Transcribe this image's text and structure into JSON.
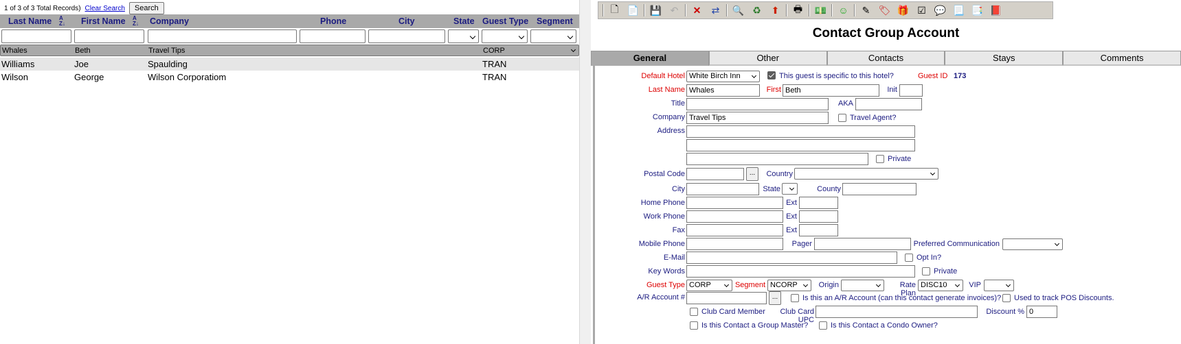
{
  "list": {
    "record_count": "1 of 3 of 3 Total Records)",
    "clear_search": "Clear Search",
    "search_button": "Search",
    "columns": {
      "last_name": "Last Name",
      "first_name": "First Name",
      "company": "Company",
      "phone": "Phone",
      "city": "City",
      "state": "State",
      "guest_type": "Guest Type",
      "segment": "Segment"
    },
    "rows": [
      {
        "last_name": "Whales",
        "first_name": "Beth",
        "company": "Travel Tips",
        "guest_type": "CORP"
      },
      {
        "last_name": "Williams",
        "first_name": "Joe",
        "company": "Spaulding",
        "guest_type": "TRAN"
      },
      {
        "last_name": "Wilson",
        "first_name": "George",
        "company": "Wilson Corporatiom",
        "guest_type": "TRAN"
      }
    ]
  },
  "form": {
    "title": "Contact Group Account",
    "tabs": [
      "General",
      "Other",
      "Contacts",
      "Stays",
      "Comments"
    ],
    "labels": {
      "default_hotel": "Default Hotel",
      "hotel_specific": "This guest is specific to this hotel?",
      "guest_id": "Guest ID",
      "last_name": "Last Name",
      "first": "First",
      "init": "Init",
      "title": "Title",
      "aka": "AKA",
      "company": "Company",
      "travel_agent": "Travel Agent?",
      "address": "Address",
      "private": "Private",
      "postal_code": "Postal Code",
      "country": "Country",
      "city": "City",
      "state": "State",
      "county": "County",
      "home_phone": "Home Phone",
      "work_phone": "Work Phone",
      "fax": "Fax",
      "ext": "Ext",
      "mobile_phone": "Mobile Phone",
      "pager": "Pager",
      "preferred_comm": "Preferred Communication",
      "email": "E-Mail",
      "opt_in": "Opt In?",
      "key_words": "Key Words",
      "guest_type": "Guest Type",
      "segment": "Segment",
      "origin": "Origin",
      "rate_plan": "Rate Plan",
      "vip": "VIP",
      "ar_account": "A/R Account #",
      "is_ar": "Is this an A/R Account (can this contact generate invoices)?",
      "pos_discounts": "Used to track POS Discounts.",
      "club_card_member": "Club Card Member",
      "club_card_upc": "Club Card UPC",
      "discount": "Discount %",
      "group_master": "Is this Contact a Group Master?",
      "condo_owner": "Is this Contact a Condo Owner?"
    },
    "values": {
      "default_hotel": "White Birch Inn",
      "guest_id": "173",
      "last_name": "Whales",
      "first": "Beth",
      "company": "Travel  Tips",
      "guest_type": "CORP",
      "segment": "NCORP",
      "rate_plan": "DISC10",
      "discount": "0",
      "ellipsis": "..."
    }
  }
}
